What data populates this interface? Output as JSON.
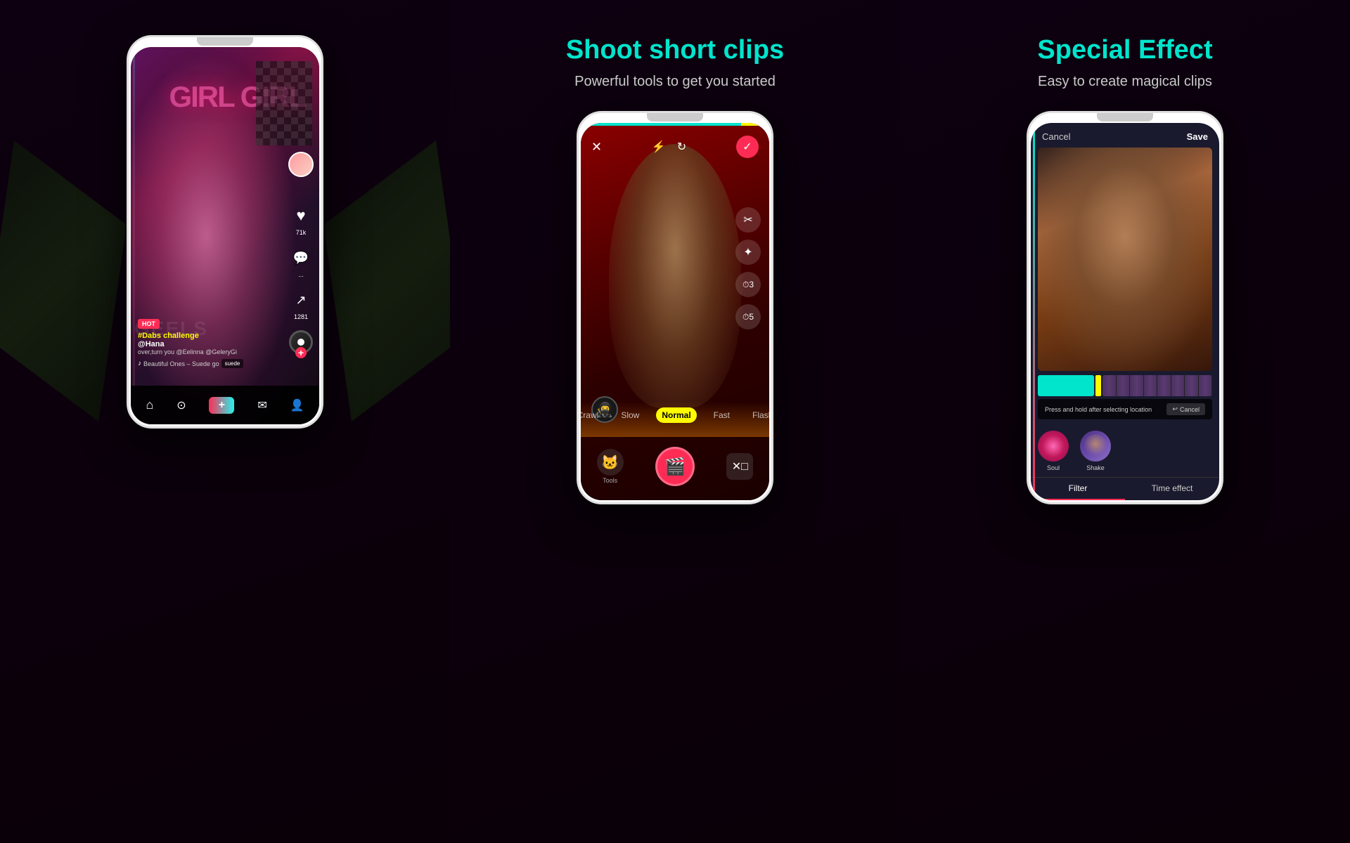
{
  "panels": [
    {
      "title": "",
      "subtitle": "",
      "feed": {
        "hot_badge": "HOT",
        "hashtag": "#Dabs challenge",
        "username": "@Hana",
        "description": "over,turn you @Eelinna @GeleryGi",
        "music": "Beautiful Ones – Suede go",
        "suede": "suede",
        "likes": "71k",
        "comments": "...",
        "shares": "1281",
        "girl_text": "GIRL\nGIRL",
        "geels_text": "GEELS"
      },
      "nav": {
        "home": "⌂",
        "discover": "🔍",
        "add": "+",
        "inbox": "💬",
        "profile": "👤"
      }
    },
    {
      "title": "Shoot short clips",
      "subtitle": "Powerful tools to get you started",
      "speeds": [
        "Crawl",
        "Slow",
        "Normal",
        "Fast",
        "Flash"
      ],
      "active_speed": "Normal",
      "tools": {
        "scissors": "✂",
        "sparkle": "✦",
        "timer_3": "⏱",
        "timer_5": "⏱"
      }
    },
    {
      "title": "Special Effect",
      "subtitle": "Easy to create magical clips",
      "header": {
        "cancel": "Cancel",
        "save": "Save"
      },
      "instruction": "Press and hold after selecting location",
      "cancel_small": "↩ Cancel",
      "filters": [
        {
          "name": "Soul",
          "type": "soul"
        },
        {
          "name": "Shake",
          "type": "shake"
        }
      ],
      "tabs": [
        "Filter",
        "Time effect"
      ],
      "active_tab": "Filter"
    }
  ],
  "colors": {
    "teal": "#00e5cc",
    "pink": "#fe2c55",
    "yellow": "#fffc00",
    "dark": "#0a0a0a"
  }
}
